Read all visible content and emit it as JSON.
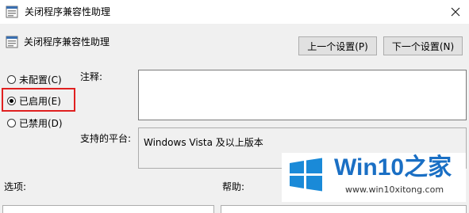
{
  "window": {
    "title": "关闭程序兼容性助理",
    "close_icon": "close-icon",
    "app_icon": "policy-setting-icon"
  },
  "header": {
    "setting_name": "关闭程序兼容性助理",
    "prev_button": "上一个设置(P)",
    "next_button": "下一个设置(N)"
  },
  "state": {
    "options": [
      {
        "label": "未配置(C)",
        "selected": false
      },
      {
        "label": "已启用(E)",
        "selected": true
      },
      {
        "label": "已禁用(D)",
        "selected": false
      }
    ],
    "highlight_color": "#e02020"
  },
  "comment": {
    "label": "注释:",
    "value": ""
  },
  "platform": {
    "label": "支持的平台:",
    "value": "Windows Vista 及以上版本"
  },
  "options_section": {
    "label": "选项:"
  },
  "help_section": {
    "label": "帮助:"
  },
  "watermark": {
    "title": "Win10之家",
    "url": "www.win10xitong.com",
    "logo_icon": "windows-logo-icon",
    "brand_color": "#1a6fc4"
  }
}
